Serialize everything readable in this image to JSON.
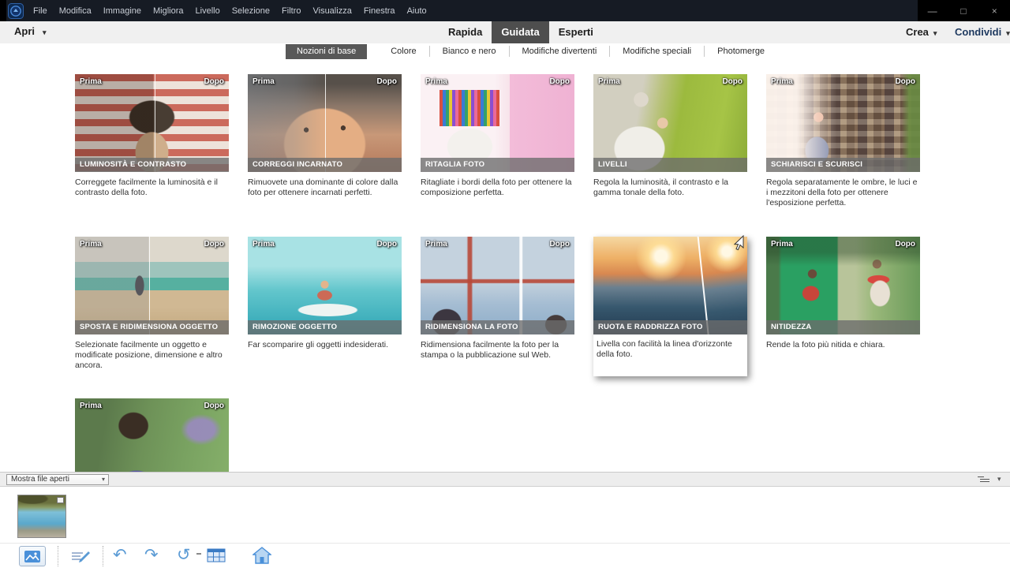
{
  "menubar": {
    "app_icon": "photoshop-elements-logo",
    "items": [
      "File",
      "Modifica",
      "Immagine",
      "Migliora",
      "Livello",
      "Selezione",
      "Filtro",
      "Visualizza",
      "Finestra",
      "Aiuto"
    ]
  },
  "window_controls": {
    "minimize": "—",
    "maximize": "□",
    "close": "×"
  },
  "header": {
    "open_label": "Apri",
    "tabs": [
      "Rapida",
      "Guidata",
      "Esperti"
    ],
    "active_tab": "Guidata",
    "create_label": "Crea",
    "share_label": "Condividi",
    "dropdown_glyph": "▾"
  },
  "subtabs": {
    "items": [
      "Nozioni di base",
      "Colore",
      "Bianco e nero",
      "Modifiche divertenti",
      "Modifiche speciali",
      "Photomerge"
    ],
    "active": "Nozioni di base"
  },
  "labels": {
    "before": "Prima",
    "after": "Dopo"
  },
  "cards": [
    {
      "title": "LUMINOSITÀ E CONTRASTO",
      "description": "Correggete facilmente la luminosità e il contrasto della foto."
    },
    {
      "title": "CORREGGI INCARNATO",
      "description": "Rimuovete una dominante di colore dalla foto per ottenere incarnati perfetti."
    },
    {
      "title": "RITAGLIA FOTO",
      "description": "Ritagliate i bordi della foto per ottenere la composizione perfetta."
    },
    {
      "title": "LIVELLI",
      "description": "Regola la luminosità, il contrasto e la gamma tonale della foto."
    },
    {
      "title": "SCHIARISCI E SCURISCI",
      "description": "Regola separatamente le ombre, le luci e i mezzitoni della foto per ottenere l'esposizione perfetta."
    },
    {
      "title": "SPOSTA E RIDIMENSIONA OGGETTO",
      "description": "Selezionate facilmente un oggetto e modificate posizione, dimensione e altro ancora."
    },
    {
      "title": "RIMOZIONE OGGETTO",
      "description": "Far scomparire gli oggetti indesiderati."
    },
    {
      "title": "RIDIMENSIONA LA FOTO",
      "description": "Ridimensiona facilmente la foto per la stampa o la pubblicazione sul Web."
    },
    {
      "title": "RUOTA E RADDRIZZA FOTO",
      "description": "Livella con facilità la linea d'orizzonte della foto."
    },
    {
      "title": "NITIDEZZA",
      "description": "Rende la foto più nitida e chiara."
    },
    {
      "title": "",
      "description": ""
    }
  ],
  "photobin": {
    "dropdown_label": "Mostra file aperti",
    "dropdown_glyph": "▾",
    "thumbnail": "lake-photo"
  },
  "toolbar": {
    "undo_glyph": "↶",
    "redo_glyph": "↷",
    "rotate_glyph": "↺"
  }
}
